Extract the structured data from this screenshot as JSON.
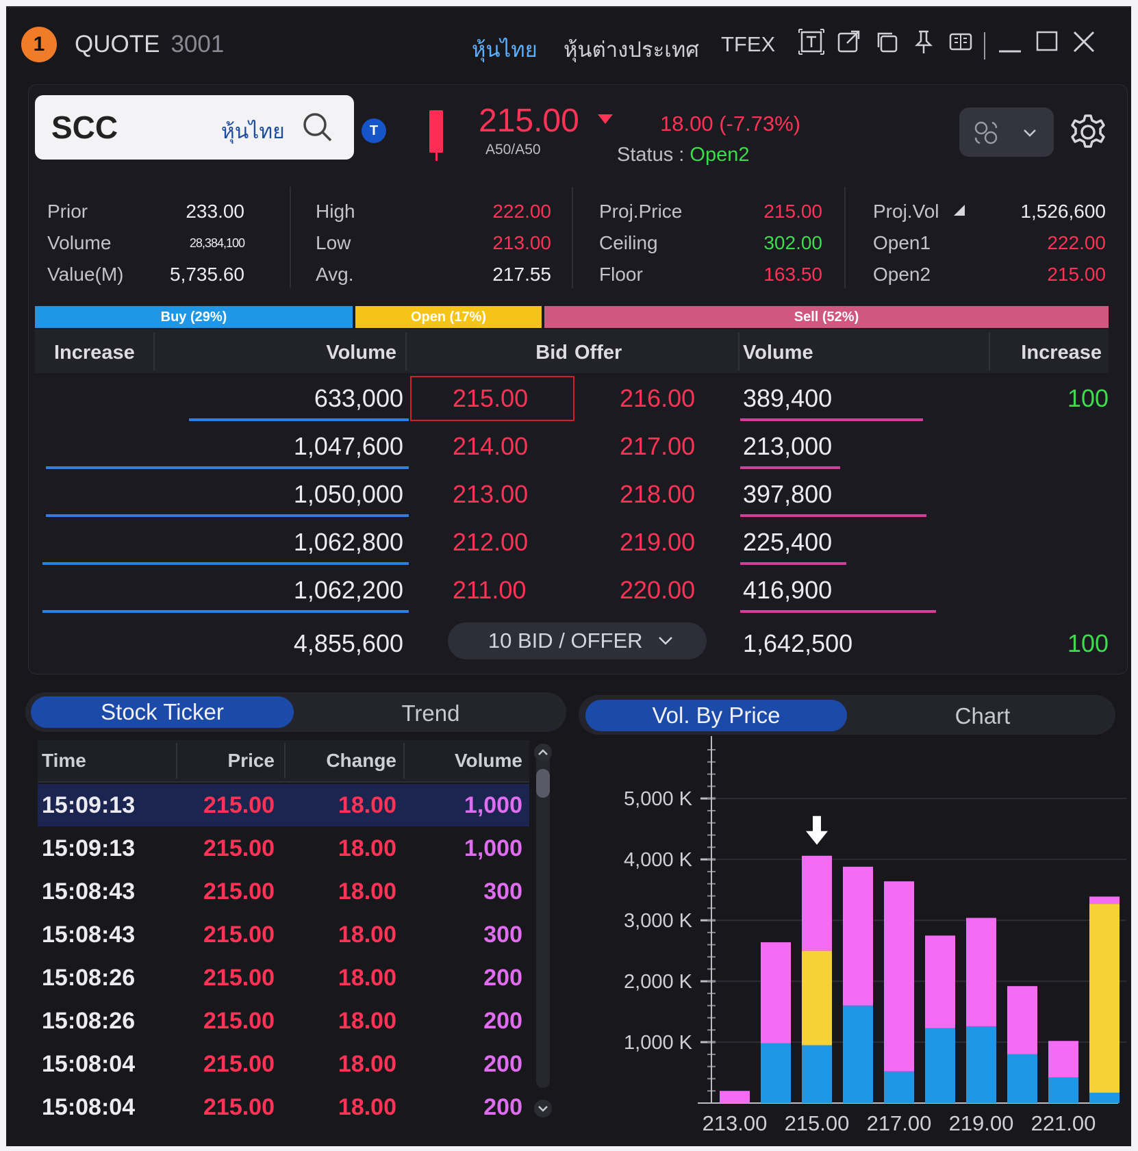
{
  "window": {
    "badge": "1",
    "title": "QUOTE",
    "code": "3001",
    "nav": [
      "หุ้นไทย",
      "หุ้นต่างประเทศ",
      "TFEX"
    ]
  },
  "quote": {
    "symbol": "SCC",
    "market": "หุ้นไทย",
    "t_badge": "T",
    "last": "215.00",
    "sub": "A50/A50",
    "change": "18.00 (-7.73%)",
    "status_label": "Status :",
    "status_value": "Open2"
  },
  "stats": {
    "col1": [
      [
        "Prior",
        "233.00"
      ],
      [
        "Volume",
        "28,384,100"
      ],
      [
        "Value(M)",
        "5,735.60"
      ]
    ],
    "col2": [
      [
        "High",
        "222.00"
      ],
      [
        "Low",
        "213.00"
      ],
      [
        "Avg.",
        "217.55"
      ]
    ],
    "col3": [
      [
        "Proj.Price",
        "215.00"
      ],
      [
        "Ceiling",
        "302.00"
      ],
      [
        "Floor",
        "163.50"
      ]
    ],
    "col4": [
      [
        "Proj.Vol",
        "1,526,600"
      ],
      [
        "Open1",
        "222.00"
      ],
      [
        "Open2",
        "215.00"
      ]
    ]
  },
  "ratio": {
    "buy": "Buy (29%)",
    "open": "Open (17%)",
    "sell": "Sell (52%)",
    "buy_pct": 29,
    "open_pct": 17,
    "sell_pct": 52,
    "buy_color": "#1f97e6",
    "open_color": "#f6c416",
    "sell_color": "#d0577f"
  },
  "orderbook": {
    "headers": [
      "Increase",
      "Volume",
      "Bid",
      "Offer",
      "Volume",
      "Increase"
    ],
    "rows": [
      {
        "bid_vol": "633,000",
        "bid": "215.00",
        "offer": "216.00",
        "offer_vol": "389,400",
        "inc": "100",
        "bid_fill": 0.6,
        "offer_fill": 0.55
      },
      {
        "bid_vol": "1,047,600",
        "bid": "214.00",
        "offer": "217.00",
        "offer_vol": "213,000",
        "inc": "",
        "bid_fill": 0.99,
        "offer_fill": 0.3
      },
      {
        "bid_vol": "1,050,000",
        "bid": "213.00",
        "offer": "218.00",
        "offer_vol": "397,800",
        "inc": "",
        "bid_fill": 0.99,
        "offer_fill": 0.56
      },
      {
        "bid_vol": "1,062,800",
        "bid": "212.00",
        "offer": "219.00",
        "offer_vol": "225,400",
        "inc": "",
        "bid_fill": 1.0,
        "offer_fill": 0.32
      },
      {
        "bid_vol": "1,062,200",
        "bid": "211.00",
        "offer": "220.00",
        "offer_vol": "416,900",
        "inc": "",
        "bid_fill": 1.0,
        "offer_fill": 0.59
      }
    ],
    "total_bid_vol": "4,855,600",
    "total_offer_vol": "1,642,500",
    "total_inc": "100",
    "depth_button": "10 BID / OFFER"
  },
  "ticker": {
    "tabs": [
      "Stock Ticker",
      "Trend"
    ],
    "headers": [
      "Time",
      "Price",
      "Change",
      "Volume"
    ],
    "rows": [
      [
        "15:09:13",
        "215.00",
        "18.00",
        "1,000"
      ],
      [
        "15:09:13",
        "215.00",
        "18.00",
        "1,000"
      ],
      [
        "15:08:43",
        "215.00",
        "18.00",
        "300"
      ],
      [
        "15:08:43",
        "215.00",
        "18.00",
        "300"
      ],
      [
        "15:08:26",
        "215.00",
        "18.00",
        "200"
      ],
      [
        "15:08:26",
        "215.00",
        "18.00",
        "200"
      ],
      [
        "15:08:04",
        "215.00",
        "18.00",
        "200"
      ],
      [
        "15:08:04",
        "215.00",
        "18.00",
        "200"
      ]
    ]
  },
  "volchart_tabs": [
    "Vol. By Price",
    "Chart"
  ],
  "chart_data": {
    "type": "bar",
    "stacked": true,
    "categories": [
      "213.00",
      "214.00",
      "215.00",
      "216.00",
      "217.00",
      "218.00",
      "219.00",
      "220.00",
      "221.00",
      "222.00"
    ],
    "series": [
      {
        "color": "#1f97e6",
        "values": [
          0,
          980,
          950,
          1600,
          520,
          1230,
          1260,
          800,
          420,
          170
        ]
      },
      {
        "color": "#f6d235",
        "values": [
          0,
          0,
          1550,
          0,
          0,
          0,
          0,
          0,
          0,
          3100
        ]
      },
      {
        "color": "#f46cf4",
        "values": [
          200,
          1660,
          1560,
          2280,
          3120,
          1520,
          1780,
          1120,
          600,
          120
        ]
      }
    ],
    "y_ticks": [
      "1,000 K",
      "2,000 K",
      "3,000 K",
      "4,000 K",
      "5,000 K"
    ],
    "x_ticks": [
      "213.00",
      "215.00",
      "217.00",
      "219.00",
      "221.00"
    ],
    "ylim": [
      0,
      5800
    ],
    "marker_category": "215.00"
  }
}
